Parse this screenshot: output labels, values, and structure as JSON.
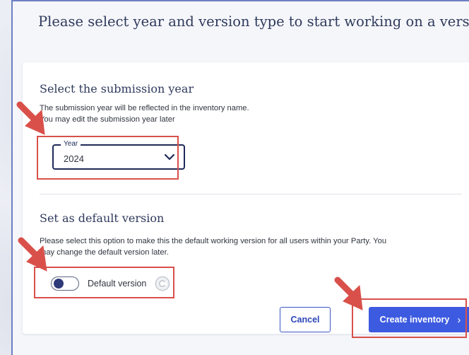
{
  "dialog": {
    "title": "Please select year and version type to start working on a version"
  },
  "year_section": {
    "title": "Select the submission year",
    "help_lines": [
      "The submission year will be reflected in the inventory name.",
      "You may edit the submission year later"
    ],
    "field": {
      "label": "Year",
      "selected": "2024",
      "icon": "chevron-down-icon"
    }
  },
  "default_section": {
    "title": "Set as default version",
    "help_lines": [
      "Please select this option to make this the default working version for all users within your Party. You",
      "may change the default version later."
    ],
    "toggle": {
      "label": "Default version",
      "checked": false,
      "icon": "copyright-icon"
    }
  },
  "actions": {
    "cancel_label": "Cancel",
    "create_label": "Create inventory",
    "create_icon": "chevron-right-icon"
  },
  "annotations": {
    "highlight_color": "#d9504a",
    "arrow_color": "#d9504a"
  },
  "colors": {
    "primary": "#3d5be0",
    "title_text": "#2f3a5c",
    "field_border": "#1f2a58"
  }
}
